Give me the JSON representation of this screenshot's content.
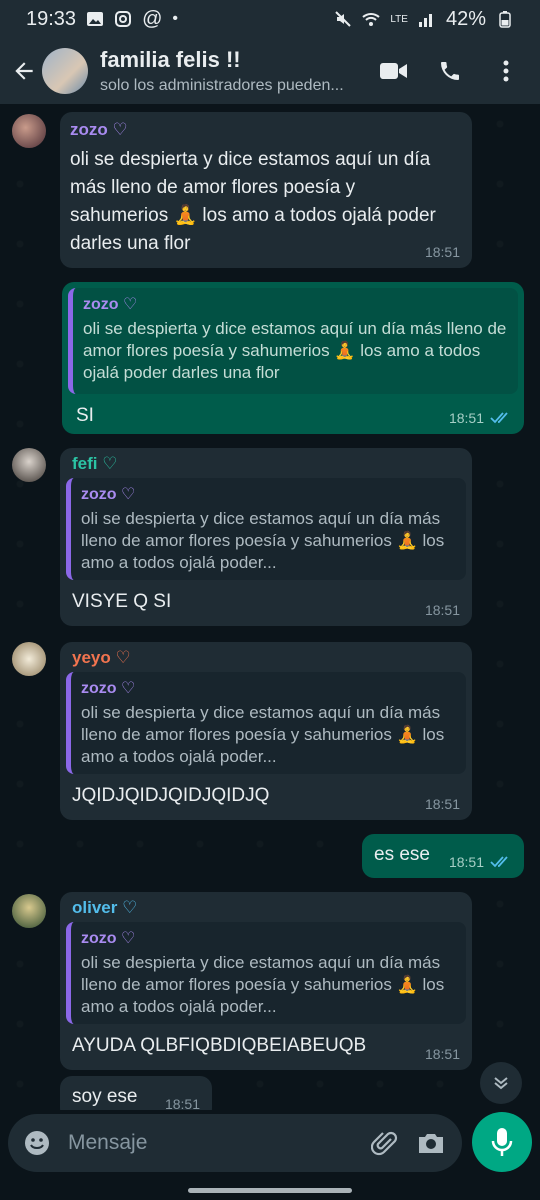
{
  "status": {
    "time": "19:33",
    "battery": "42%",
    "network": "LTE"
  },
  "header": {
    "title": "familia felis !!",
    "subtitle": "solo los administradores pueden..."
  },
  "messages": [
    {
      "sender": "zozo ♡",
      "sender_color": "#a98bf0",
      "text": "oli se despierta y dice estamos aquí un día más lleno de amor flores poesía y sahumerios 🧘 los amo a todos ojalá poder darles una flor",
      "time": "18:51"
    },
    {
      "quote_name": "zozo ♡",
      "quote_text": "oli se despierta y dice estamos aquí un día más lleno de amor flores poesía y sahumerios 🧘 los amo a todos ojalá poder darles una flor",
      "text": "SI",
      "time": "18:51"
    },
    {
      "sender": "fefi ♡",
      "sender_color": "#2bc4a4",
      "quote_name": "zozo ♡",
      "quote_text": "oli se despierta y dice estamos aquí un día más lleno de amor flores poesía y sahumerios 🧘 los amo a todos ojalá poder...",
      "text": "VISYE Q SI",
      "time": "18:51"
    },
    {
      "sender": "yeyo ♡",
      "sender_color": "#f2744f",
      "quote_name": "zozo ♡",
      "quote_text": "oli se despierta y dice estamos aquí un día más lleno de amor flores poesía y sahumerios 🧘 los amo a todos ojalá poder...",
      "text": "JQIDJQIDJQIDJQIDJQ",
      "time": "18:51"
    },
    {
      "text": "es ese",
      "time": "18:51"
    },
    {
      "sender": "oliver ♡",
      "sender_color": "#53bdeb",
      "quote_name": "zozo ♡",
      "quote_text": "oli se despierta y dice estamos aquí un día más lleno de amor flores poesía y sahumerios 🧘 los amo a todos ojalá poder...",
      "text": "AYUDA QLBFIQBDIQBEIABEUQB",
      "time": "18:51"
    },
    {
      "text": "soy ese",
      "time": "18:51"
    }
  ],
  "composer": {
    "placeholder": "Mensaje"
  },
  "icons": [
    "back-arrow-icon",
    "video-call-icon",
    "phone-icon",
    "more-icon",
    "emoji-icon",
    "attach-icon",
    "camera-icon",
    "mic-icon",
    "chevron-down-icon",
    "double-check-icon"
  ]
}
